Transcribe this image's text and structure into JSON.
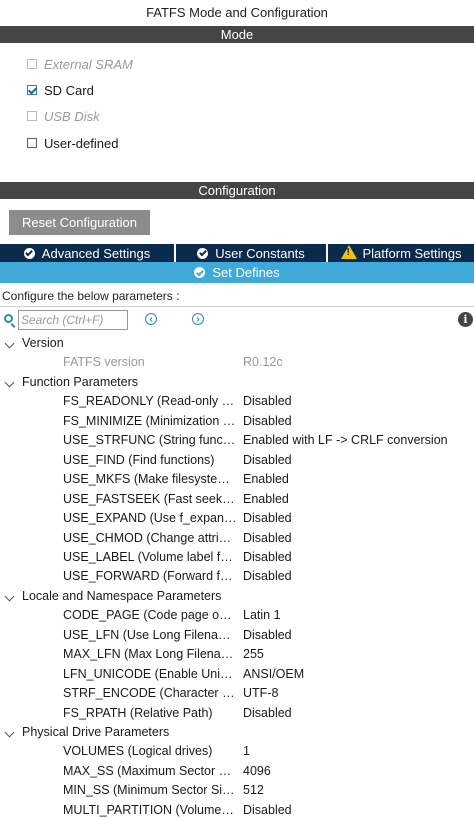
{
  "window": {
    "title": "FATFS Mode and Configuration"
  },
  "mode": {
    "header": "Mode",
    "options": [
      {
        "label": "External SRAM",
        "checked": false,
        "disabled": true
      },
      {
        "label": "SD Card",
        "checked": true,
        "disabled": false
      },
      {
        "label": "USB Disk",
        "checked": false,
        "disabled": true
      },
      {
        "label": "User-defined",
        "checked": false,
        "disabled": false
      }
    ]
  },
  "config": {
    "header": "Configuration",
    "reset_label": "Reset Configuration",
    "tabs": [
      {
        "label": "Advanced Settings",
        "icon": "check-circle-icon"
      },
      {
        "label": "User Constants",
        "icon": "check-circle-icon"
      },
      {
        "label": "Platform Settings",
        "icon": "warning-icon"
      }
    ],
    "active_tab": {
      "label": "Set Defines",
      "icon": "check-circle-icon"
    },
    "instructions": "Configure the below parameters :",
    "search": {
      "placeholder": "Search (Ctrl+F)",
      "value": ""
    },
    "nav": {
      "prev": "‹",
      "next": "›"
    },
    "info": "i"
  },
  "tree": [
    {
      "group": "Version",
      "params": [
        {
          "name": "FATFS version",
          "value": "R0.12c",
          "muted": true
        }
      ]
    },
    {
      "group": "Function Parameters",
      "params": [
        {
          "name": "FS_READONLY (Read-only …",
          "value": "Disabled"
        },
        {
          "name": "FS_MINIMIZE (Minimization l…",
          "value": "Disabled"
        },
        {
          "name": "USE_STRFUNC (String funct…",
          "value": "Enabled with LF -> CRLF conversion"
        },
        {
          "name": "USE_FIND (Find functions)",
          "value": "Disabled"
        },
        {
          "name": "USE_MKFS (Make filesyste…",
          "value": "Enabled"
        },
        {
          "name": "USE_FASTSEEK (Fast seek…",
          "value": "Enabled"
        },
        {
          "name": "USE_EXPAND (Use f_expan…",
          "value": "Disabled"
        },
        {
          "name": "USE_CHMOD (Change attrib…",
          "value": "Disabled"
        },
        {
          "name": "USE_LABEL (Volume label f…",
          "value": "Disabled"
        },
        {
          "name": "USE_FORWARD (Forward fu…",
          "value": "Disabled"
        }
      ]
    },
    {
      "group": "Locale and Namespace Parameters",
      "params": [
        {
          "name": "CODE_PAGE (Code page on…",
          "value": "Latin 1"
        },
        {
          "name": "USE_LFN (Use Long Filename)",
          "value": "Disabled"
        },
        {
          "name": "MAX_LFN (Max Long Filena…",
          "value": "255"
        },
        {
          "name": "LFN_UNICODE (Enable Unic…",
          "value": "ANSI/OEM"
        },
        {
          "name": "STRF_ENCODE (Character e…",
          "value": "UTF-8"
        },
        {
          "name": "FS_RPATH (Relative Path)",
          "value": "Disabled"
        }
      ]
    },
    {
      "group": "Physical Drive Parameters",
      "params": [
        {
          "name": "VOLUMES (Logical drives)",
          "value": "1"
        },
        {
          "name": "MAX_SS (Maximum Sector …",
          "value": "4096"
        },
        {
          "name": "MIN_SS (Minimum Sector Si…",
          "value": "512"
        },
        {
          "name": "MULTI_PARTITION (Volume…",
          "value": "Disabled"
        }
      ]
    }
  ]
}
